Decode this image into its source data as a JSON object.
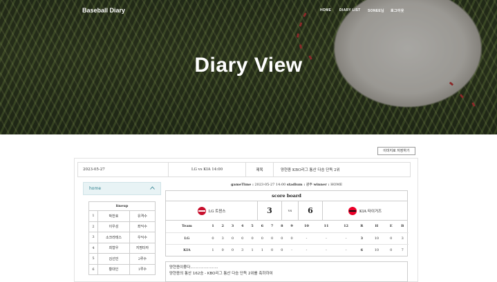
{
  "nav": {
    "brand": "Baseball Diary",
    "home": "HOME",
    "diary_list": "DIARY LIST",
    "user": "SONEE님",
    "logout": "로그아웃"
  },
  "hero": {
    "title": "Diary View"
  },
  "actions": {
    "save_image": "이미지로 저장하기"
  },
  "diary": {
    "date": "2023-05-27",
    "match": "LG vs KIA 14:00",
    "subject_label": "제목",
    "subject": "양현종 KBO리그 통산 다승 단독 2위",
    "gametime_label": "gameTime :",
    "gametime": "2023-05-27 14:00",
    "stadium_label": "stadium :",
    "stadium": "광주",
    "winner_label": "winner :",
    "winner": "HOME"
  },
  "sidebar": {
    "label": "home",
    "lineup_title": "lineup",
    "lineup": [
      {
        "no": "1",
        "name": "박찬호",
        "pos": "유격수"
      },
      {
        "no": "2",
        "name": "이우성",
        "pos": "좌익수"
      },
      {
        "no": "3",
        "name": "소크라테스",
        "pos": "우익수"
      },
      {
        "no": "4",
        "name": "최형우",
        "pos": "지명타자"
      },
      {
        "no": "5",
        "name": "김선빈",
        "pos": "2루수"
      },
      {
        "no": "6",
        "name": "황대인",
        "pos": "1루수"
      }
    ]
  },
  "scoreboard": {
    "title": "score board",
    "away_team": "LG 트윈스",
    "home_team": "KIA 타이거즈",
    "away_score": "3",
    "home_score": "6",
    "vs": "vs",
    "header": [
      "Team",
      "1",
      "2",
      "3",
      "4",
      "5",
      "6",
      "7",
      "8",
      "9",
      "10",
      "11",
      "12",
      "R",
      "H",
      "E",
      "B"
    ],
    "rows": [
      [
        "LG",
        "0",
        "3",
        "0",
        "0",
        "0",
        "0",
        "0",
        "0",
        "0",
        "-",
        "-",
        "-",
        "3",
        "10",
        "0",
        "3"
      ],
      [
        "KIA",
        "1",
        "0",
        "0",
        "3",
        "1",
        "1",
        "0",
        "0",
        "-",
        "-",
        "-",
        "-",
        "6",
        "10",
        "0",
        "7"
      ]
    ]
  },
  "content": {
    "line1": "양현종이좋다.......................",
    "line2": "양현종의 통산 162승 - KBO리그 통산 다승 단독 2위를 축하하여"
  },
  "colors": {
    "accent": "#2d7f8d",
    "stitch": "#8a2a2a"
  }
}
